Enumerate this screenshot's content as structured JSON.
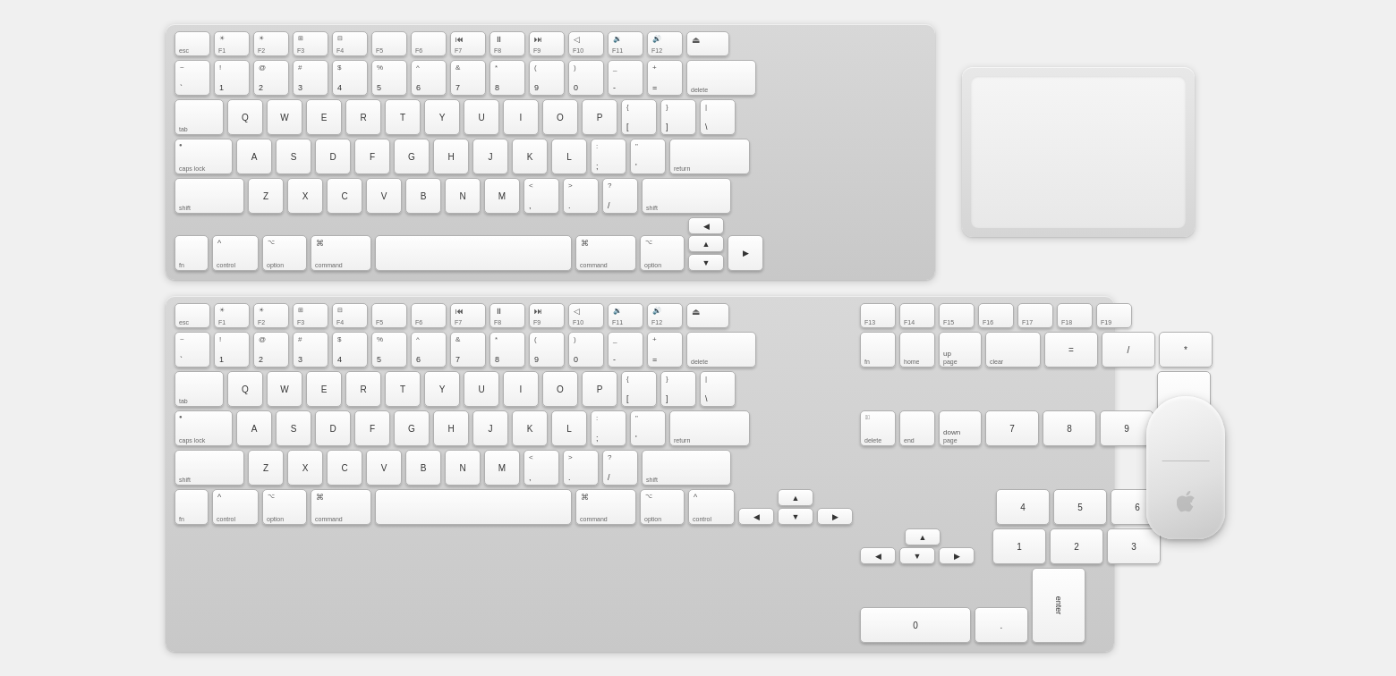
{
  "keyboards": {
    "compact": {
      "label": "Apple Magic Keyboard"
    },
    "extended": {
      "label": "Apple Magic Keyboard with Numeric Keypad"
    }
  },
  "trackpad": {
    "label": "Apple Magic Trackpad"
  },
  "mouse": {
    "label": "Apple Magic Mouse"
  }
}
